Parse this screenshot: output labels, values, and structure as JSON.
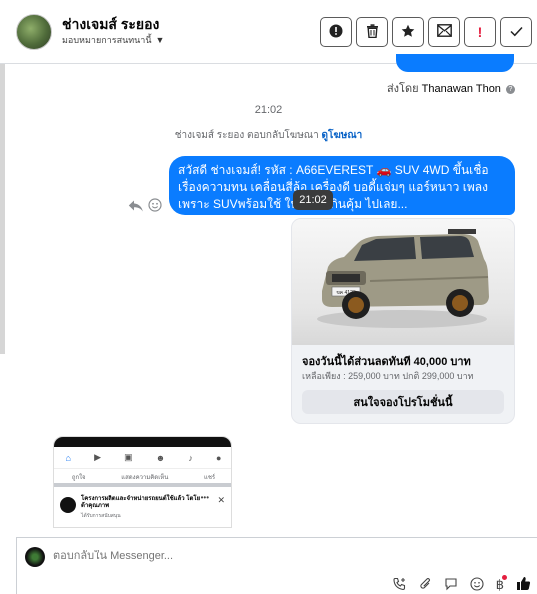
{
  "header": {
    "contact_name": "ช่างเจมส์ ระยอง",
    "assign_label": "มอบหมายการสนทนานี้",
    "buttons": [
      {
        "name": "mark-spam-button",
        "icon": "alert-circle-icon",
        "glyph": "ⓘ"
      },
      {
        "name": "delete-button",
        "icon": "trash-icon",
        "glyph": "🗑"
      },
      {
        "name": "star-button",
        "icon": "star-icon",
        "glyph": "★"
      },
      {
        "name": "mark-unread-button",
        "icon": "envelope-icon",
        "glyph": "✉"
      },
      {
        "name": "follow-up-button",
        "icon": "exclamation-icon",
        "glyph": "!"
      },
      {
        "name": "done-button",
        "icon": "check-icon",
        "glyph": "✓"
      }
    ]
  },
  "messages": {
    "sent_by_prefix": "ส่งโดย",
    "sent_by_name": "Thanawan Thon",
    "timestamp": "21:02",
    "ad_reply_text": "ช่างเจมส์ ระยอง ตอบกลับโฆษณา",
    "ad_reply_link": "ดูโฆษณา",
    "bubble_text": "สวัสดี ช่างเจมส์!  รหัส : A66EVEREST 🚗 SUV 4WD ขึ้นเชื่อเรื่องความทน เคลื่อนสี่ล้อ เครื่องดี บอดี้แจ่มๆ แอร์หนาว เพลงเพราะ SUVพร้อมใช้ ในราคาเกินคุ้ม ไปเลย...",
    "tooltip_time": "21:02"
  },
  "ad_card": {
    "title": "จองวันนี้ได้ส่วนลดทันที 40,000 บาท",
    "subtitle": "เหลือเพียง : 259,000 บาท ปกติ 299,000 บาท",
    "cta": "สนใจจองโปรโมชั่นนี้",
    "plate_text": "ขค 4123"
  },
  "thumbnail": {
    "actions": [
      "ถูกใจ",
      "แสดงความคิดเห็น",
      "แชร์"
    ],
    "post_title": "โครงการผลิตและจำหน่ายรถยนต์ใช้แล้ว โตโยต้าคุณภาพ",
    "post_sub": "ได้รับการสนับสนุน"
  },
  "composer": {
    "placeholder": "ตอบกลับใน Messenger..."
  },
  "colors": {
    "messenger_blue": "#0a7cff",
    "link_blue": "#0a63c7",
    "badge_red": "#e41e3f"
  }
}
